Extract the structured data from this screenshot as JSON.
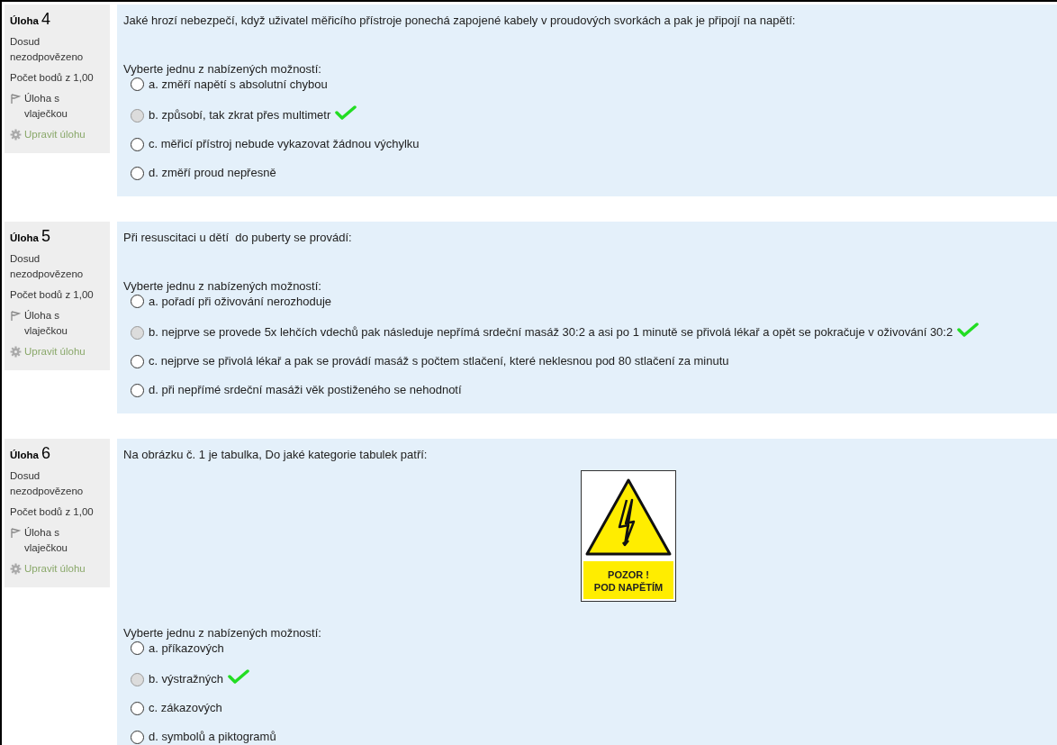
{
  "questions": [
    {
      "label": "Úloha",
      "number": "4",
      "status": "Dosud nezodpovězeno",
      "points": "Počet bodů z 1,00",
      "flag": "Úloha s vlaječkou",
      "edit": "Upravit úlohu",
      "text": "Jaké hrozí nebezpečí, když uživatel měřicího přístroje ponechá zapojené kabely v proudových svorkách a pak je připojí na napětí:",
      "prompt": "Vyberte jednu z nabízených možností:",
      "options": [
        {
          "text": "a. změří napětí s absolutní chybou",
          "correct": false
        },
        {
          "text": "b. způsobí, tak zkrat přes multimetr",
          "correct": true
        },
        {
          "text": "c. měřicí přístroj nebude vykazovat žádnou výchylku",
          "correct": false
        },
        {
          "text": "d. změří proud nepřesně",
          "correct": false
        }
      ]
    },
    {
      "label": "Úloha",
      "number": "5",
      "status": "Dosud nezodpovězeno",
      "points": "Počet bodů z 1,00",
      "flag": "Úloha s vlaječkou",
      "edit": "Upravit úlohu",
      "text": "Při resuscitaci u dětí  do puberty se provádí:",
      "prompt": "Vyberte jednu z nabízených možností:",
      "options": [
        {
          "text": "a. pořadí při oživování nerozhoduje",
          "correct": false
        },
        {
          "text": "b. nejprve se provede 5x lehčích vdechů pak následuje nepřímá srdeční masáž 30:2 a asi po 1 minutě se přivolá lékař a opět se pokračuje v oživování 30:2",
          "correct": true
        },
        {
          "text": "c. nejprve se přivolá lékař a pak se provádí masáž s počtem stlačení, které neklesnou pod 80 stlačení za minutu",
          "correct": false
        },
        {
          "text": "d. při nepřímé srdeční masáži věk postiženého se nehodnotí",
          "correct": false
        }
      ]
    },
    {
      "label": "Úloha",
      "number": "6",
      "status": "Dosud nezodpovězeno",
      "points": "Počet bodů z 1,00",
      "flag": "Úloha s vlaječkou",
      "edit": "Upravit úlohu",
      "text": "Na obrázku č. 1 je tabulka, Do jaké kategorie tabulek patří:",
      "figure": {
        "lines": [
          "POZOR !",
          "POD NAPĚTÍM"
        ]
      },
      "prompt": "Vyberte jednu z nabízených možností:",
      "options": [
        {
          "text": "a. příkazových",
          "correct": false
        },
        {
          "text": "b. výstražných",
          "correct": true
        },
        {
          "text": "c. zákazových",
          "correct": false
        },
        {
          "text": "d. symbolů a piktogramů",
          "correct": false
        }
      ]
    }
  ]
}
